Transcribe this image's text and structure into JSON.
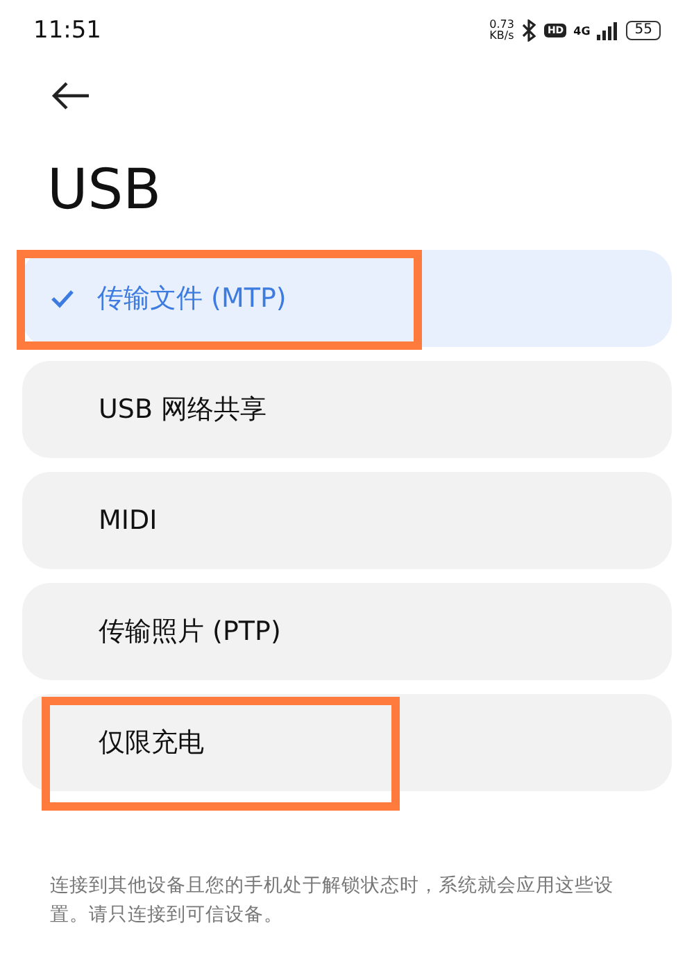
{
  "status_bar": {
    "time": "11:51",
    "speed_value": "0.73",
    "speed_unit": "KB/s",
    "hd_badge": "HD",
    "network": "4G",
    "battery": "55"
  },
  "title": "USB",
  "options": [
    {
      "label": "传输文件 (MTP)",
      "selected": true,
      "highlighted": true
    },
    {
      "label": "USB 网络共享",
      "selected": false,
      "highlighted": false
    },
    {
      "label": "MIDI",
      "selected": false,
      "highlighted": false
    },
    {
      "label": "传输照片 (PTP)",
      "selected": false,
      "highlighted": false
    },
    {
      "label": "仅限充电",
      "selected": false,
      "highlighted": true
    }
  ],
  "footer": "连接到其他设备且您的手机处于解锁状态时，系统就会应用这些设置。请只连接到可信设备。"
}
